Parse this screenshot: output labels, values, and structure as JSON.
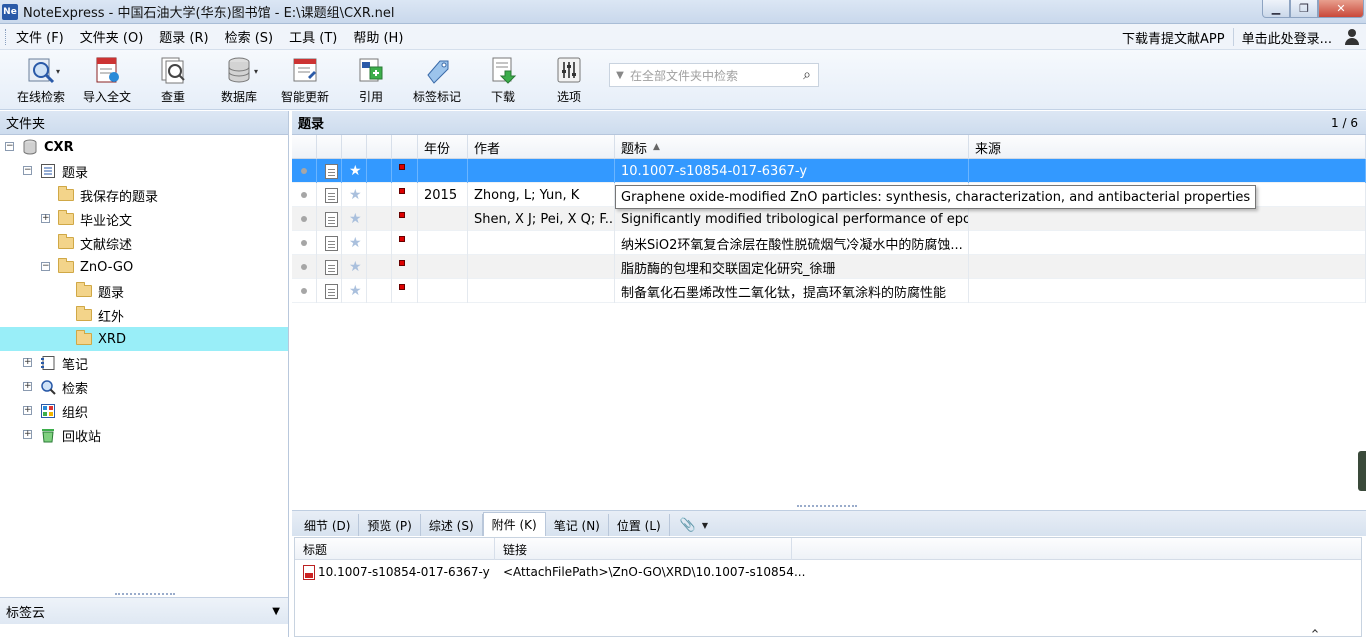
{
  "window": {
    "app_icon_text": "Ne",
    "title": "NoteExpress - 中国石油大学(华东)图书馆 - E:\\课题组\\CXR.nel",
    "controls": {
      "minimize": "▁",
      "maximize": "❐",
      "close": "✕"
    }
  },
  "menu": {
    "items": [
      "文件 (F)",
      "文件夹 (O)",
      "题录 (R)",
      "检索 (S)",
      "工具 (T)",
      "帮助 (H)"
    ],
    "right": {
      "download_app": "下载青提文献APP",
      "login": "单击此处登录..."
    }
  },
  "toolbar": {
    "buttons": [
      {
        "label": "在线检索",
        "icon": "online-search-icon"
      },
      {
        "label": "导入全文",
        "icon": "import-fulltext-icon"
      },
      {
        "label": "查重",
        "icon": "duplicate-check-icon"
      },
      {
        "label": "数据库",
        "icon": "database-icon"
      },
      {
        "label": "智能更新",
        "icon": "smart-update-icon"
      },
      {
        "label": "引用",
        "icon": "cite-icon"
      },
      {
        "label": "标签标记",
        "icon": "tag-icon"
      },
      {
        "label": "下载",
        "icon": "download-icon"
      },
      {
        "label": "选项",
        "icon": "options-icon"
      }
    ],
    "search_placeholder": "在全部文件夹中检索"
  },
  "folders": {
    "header": "文件夹",
    "root": "CXR",
    "items": {
      "records": "题录",
      "saved": "我保存的题录",
      "thesis": "毕业论文",
      "review": "文献综述",
      "zno_go": "ZnO-GO",
      "zno_records": "题录",
      "infrared": "红外",
      "xrd": "XRD",
      "notes": "笔记",
      "search": "检索",
      "organize": "组织",
      "recycle": "回收站"
    },
    "tagcloud": "标签云"
  },
  "records": {
    "header": "题录",
    "page_count": "1 / 6",
    "columns": {
      "year": "年份",
      "author": "作者",
      "title": "题标",
      "source": "来源"
    },
    "rows": [
      {
        "year": "",
        "author": "",
        "title": "10.1007-s10854-017-6367-y",
        "source": ""
      },
      {
        "year": "2015",
        "author": "Zhong, L; Yun, K",
        "title": "Graphene oxide-modified ZnO particles: synthesis, characterization, and antibacterial properties",
        "source": ""
      },
      {
        "year": "",
        "author": "Shen, X J; Pei, X Q; F...",
        "title": "Significantly modified tribological performance of epo...",
        "source": ""
      },
      {
        "year": "",
        "author": "",
        "title": "纳米SiO2环氧复合涂层在酸性脱硫烟气冷凝水中的防腐蚀...",
        "source": ""
      },
      {
        "year": "",
        "author": "",
        "title": "脂肪酶的包埋和交联固定化研究_徐珊",
        "source": ""
      },
      {
        "year": "",
        "author": "",
        "title": "制备氧化石墨烯改性二氧化钛，提高环氧涂料的防腐性能",
        "source": ""
      }
    ],
    "tooltip": "Graphene oxide-modified ZnO particles: synthesis, characterization, and antibacterial properties"
  },
  "detail": {
    "tabs": [
      "细节 (D)",
      "预览 (P)",
      "综述 (S)",
      "附件 (K)",
      "笔记 (N)",
      "位置 (L)"
    ],
    "active_tab": "附件 (K)",
    "attachments": {
      "columns": {
        "title": "标题",
        "link": "链接"
      },
      "rows": [
        {
          "title": "10.1007-s10854-017-6367-y",
          "link": "<AttachFilePath>\\ZnO-GO\\XRD\\10.1007-s10854..."
        }
      ]
    }
  },
  "colors": {
    "selected_row": "#3399ff",
    "selected_folder": "#99eef8",
    "flag": "#dd0000"
  }
}
